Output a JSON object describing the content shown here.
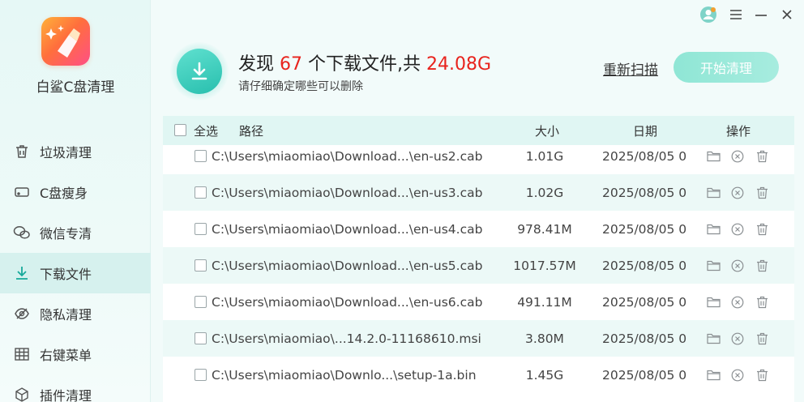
{
  "app": {
    "name": "白鲨C盘清理"
  },
  "sidebar": {
    "items": [
      {
        "label": "垃圾清理",
        "icon": "trash-icon"
      },
      {
        "label": "C盘瘦身",
        "icon": "disk-icon"
      },
      {
        "label": "微信专清",
        "icon": "wechat-icon"
      },
      {
        "label": "下载文件",
        "icon": "download-icon",
        "active": true
      },
      {
        "label": "隐私清理",
        "icon": "eye-off-icon"
      },
      {
        "label": "右键菜单",
        "icon": "grid-icon"
      },
      {
        "label": "插件清理",
        "icon": "cube-icon"
      }
    ]
  },
  "header": {
    "prefix": "发现 ",
    "count": "67",
    "middle": " 个下载文件,共 ",
    "total": "24.08G",
    "subtitle": "请仔细确定哪些可以删除",
    "rescan": "重新扫描",
    "start": "开始清理"
  },
  "table": {
    "headers": {
      "select_all": "全选",
      "path": "路径",
      "size": "大小",
      "date": "日期",
      "ops": "操作"
    },
    "rows": [
      {
        "path": "C:\\Users\\miaomiao\\Download...\\en-us2.cab",
        "size": "1.01G",
        "date": "2025/08/05 0"
      },
      {
        "path": "C:\\Users\\miaomiao\\Download...\\en-us3.cab",
        "size": "1.02G",
        "date": "2025/08/05 0"
      },
      {
        "path": "C:\\Users\\miaomiao\\Download...\\en-us4.cab",
        "size": "978.41M",
        "date": "2025/08/05 0"
      },
      {
        "path": "C:\\Users\\miaomiao\\Download...\\en-us5.cab",
        "size": "1017.57M",
        "date": "2025/08/05 0"
      },
      {
        "path": "C:\\Users\\miaomiao\\Download...\\en-us6.cab",
        "size": "491.11M",
        "date": "2025/08/05 0"
      },
      {
        "path": "C:\\Users\\miaomiao\\...14.2.0-11168610.msi",
        "size": "3.80M",
        "date": "2025/08/05 0"
      },
      {
        "path": "C:\\Users\\miaomiao\\Downlo...\\setup-1a.bin",
        "size": "1.45G",
        "date": "2025/08/05 0"
      }
    ]
  },
  "colors": {
    "accent": "#1fb3a3",
    "highlight": "#e8231d",
    "button": "#9be9da"
  }
}
